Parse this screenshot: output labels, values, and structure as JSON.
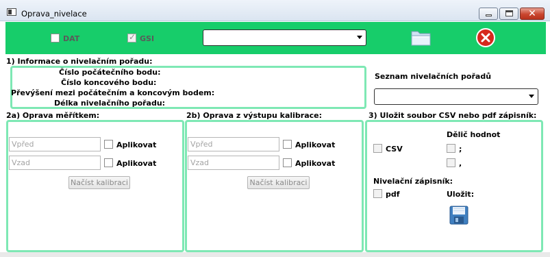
{
  "window": {
    "title": "Oprava_nivelace"
  },
  "toolbar": {
    "dat_label": "DAT",
    "gsi_label": "GSI",
    "gsi_checked": true,
    "dat_checked": false,
    "file_combo_value": "",
    "open_icon": "folder-open-icon",
    "exit_icon": "exit-icon",
    "accent_color": "#17cd6a"
  },
  "info": {
    "title": "1) Informace o nivelačním pořadu:",
    "lines": [
      "Číslo počátečního bodu:",
      "Číslo koncového bodu:",
      "Převýšení mezi počátečním a koncovým bodem:",
      "Délka nivelačního pořadu:"
    ]
  },
  "route_list": {
    "label": "Seznam nivelačních pořadů",
    "value": ""
  },
  "scale": {
    "title": "2a) Oprava měřítkem:",
    "forward_placeholder": "Vpřed",
    "backward_placeholder": "Vzad",
    "apply1": "Aplikovat",
    "apply2": "Aplikovat",
    "load_button": "Načíst kalibraci"
  },
  "calib": {
    "title": "2b) Oprava z výstupu kalibrace:",
    "forward_placeholder": "Vpřed",
    "backward_placeholder": "Vzad",
    "apply1": "Aplikovat",
    "apply2": "Aplikovat",
    "load_button": "Načíst kalibraci"
  },
  "save": {
    "title": "3) Uložit soubor CSV nebo pdf zápisník:",
    "csv_label": "CSV",
    "delimiter_label": "Dělič hodnot",
    "semicolon": ";",
    "comma": ",",
    "notebook_label": "Nivelační zápisník:",
    "pdf_label": "pdf",
    "save_label": "Uložit:",
    "save_icon": "floppy-disk-icon"
  }
}
